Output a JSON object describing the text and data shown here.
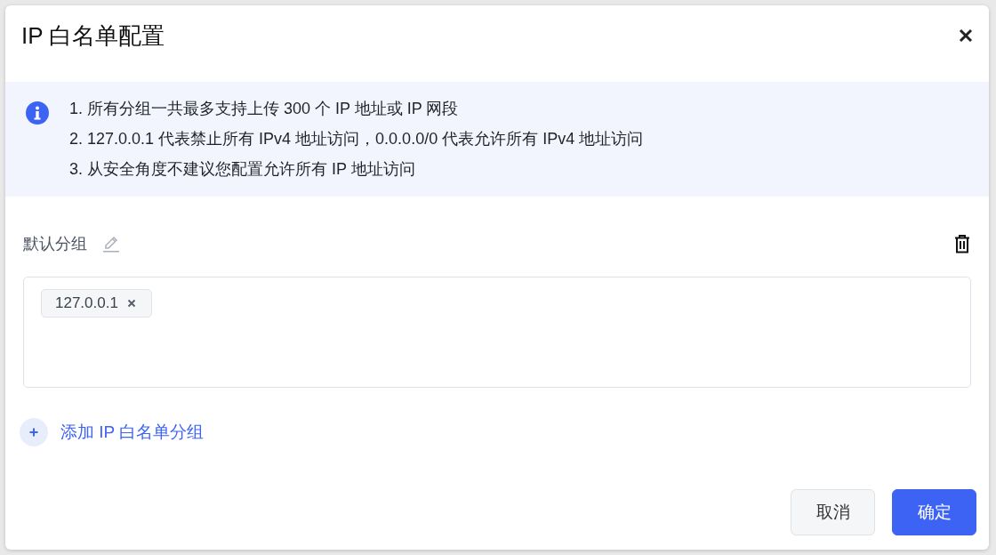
{
  "dialog": {
    "title": "IP 白名单配置"
  },
  "notice": {
    "items": [
      "1. 所有分组一共最多支持上传 300 个 IP 地址或 IP 网段",
      "2. 127.0.0.1 代表禁止所有 IPv4 地址访问，0.0.0.0/0 代表允许所有 IPv4 地址访问",
      "3. 从安全角度不建议您配置允许所有 IP 地址访问"
    ]
  },
  "groups": [
    {
      "name": "默认分组",
      "tags": [
        {
          "label": "127.0.0.1"
        }
      ]
    }
  ],
  "add_group": {
    "label": "添加 IP 白名单分组"
  },
  "buttons": [
    {
      "label": "取消",
      "kind": "secondary"
    },
    {
      "label": "确定",
      "kind": "primary"
    }
  ]
}
